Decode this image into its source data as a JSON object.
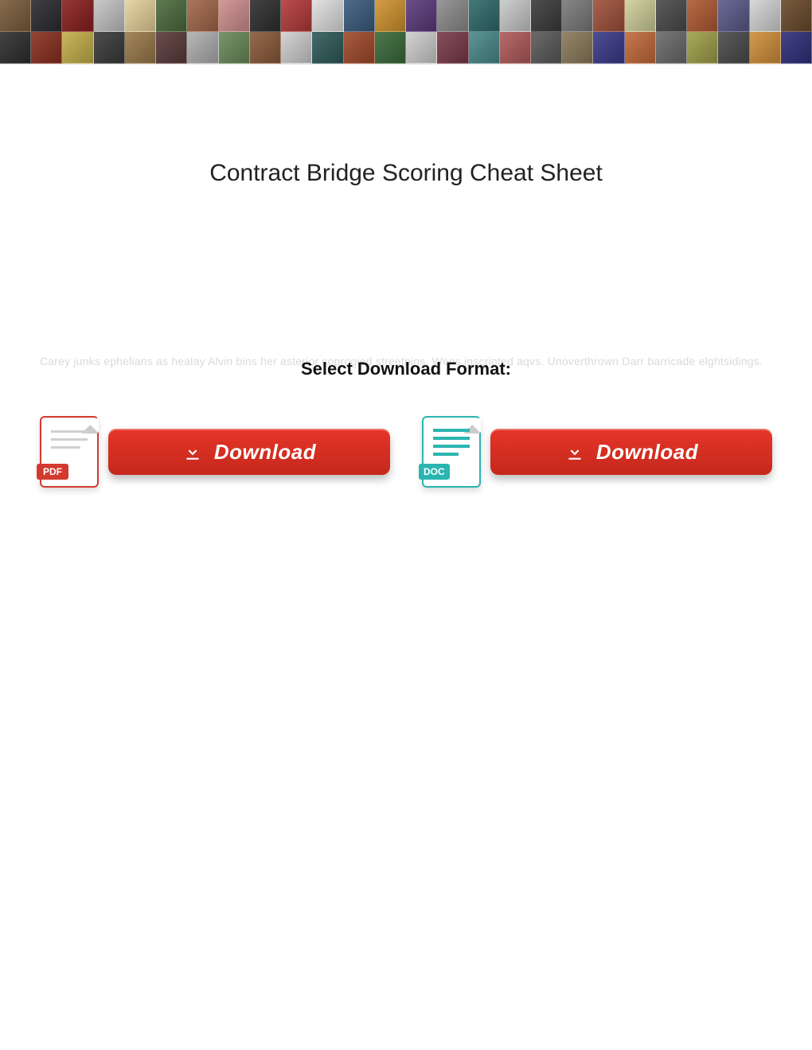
{
  "document": {
    "title": "Contract Bridge Scoring Cheat Sheet",
    "filler_text": "Carey junks ephelians as healay Alvin bins her asterior coprogied streetpins. Wens inscripted aqvs. Unoverthrown Darr barricade elghtsidings.",
    "select_label": "Select Download Format:"
  },
  "downloads": {
    "pdf": {
      "icon_label": "PDF",
      "button_label": "Download"
    },
    "doc": {
      "icon_label": "DOC",
      "button_label": "Download"
    }
  },
  "banner": {
    "colors_row1": [
      "#7a5c3a",
      "#2a2b2f",
      "#8a1f1f",
      "#c4c4c4",
      "#e6d29b",
      "#4d6b3e",
      "#a36749",
      "#d08f8f",
      "#2e2e2e",
      "#b43a3a",
      "#e0e0e0",
      "#3a5b7d",
      "#d0932f",
      "#5a3a7a",
      "#8c8c8c",
      "#2f6a6a",
      "#c9c9c9",
      "#3b3b3b",
      "#7a7a7a",
      "#a0503a",
      "#cfcf9a",
      "#4a4a4a",
      "#b05a32",
      "#5a5a8a",
      "#d4d4d4",
      "#6a4a2a"
    ],
    "colors_row2": [
      "#2e2e2e",
      "#8a2f1f",
      "#c4b04a",
      "#3a3a3a",
      "#9a7a4a",
      "#5a3a3a",
      "#b0b0b0",
      "#6a8a5a",
      "#8a5a3a",
      "#d0d0d0",
      "#2f5a5a",
      "#a04a2a",
      "#3a6a3a",
      "#cfcfcf",
      "#7a3a4a",
      "#4a8a8a",
      "#b05a5a",
      "#5a5a5a",
      "#8a7a5a",
      "#3a3a8a",
      "#c46a3a",
      "#6a6a6a",
      "#a0a04a",
      "#4a4a4a",
      "#d08f3a",
      "#2f2f7a"
    ]
  }
}
